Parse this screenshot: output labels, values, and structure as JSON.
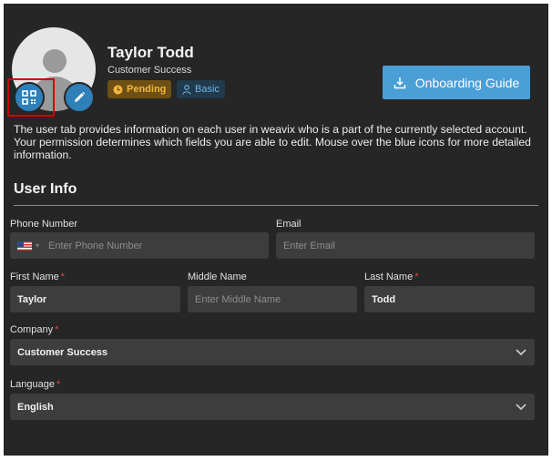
{
  "profile": {
    "name": "Taylor Todd",
    "role": "Customer Success",
    "status_badge": "Pending",
    "plan_badge": "Basic",
    "onboarding_button": "Onboarding Guide",
    "description": "The user tab provides information on each user in weavix who is a part of the currently selected account. Your permission determines which fields you are able to edit. Mouse over the blue icons for more detailed information."
  },
  "user_info": {
    "title": "User Info",
    "phone": {
      "label": "Phone Number",
      "placeholder": "Enter Phone Number",
      "flag": "us-flag-icon"
    },
    "email": {
      "label": "Email",
      "placeholder": "Enter Email"
    },
    "first_name": {
      "label": "First Name",
      "value": "Taylor",
      "required": "*"
    },
    "middle_name": {
      "label": "Middle Name",
      "placeholder": "Enter Middle Name"
    },
    "last_name": {
      "label": "Last Name",
      "value": "Todd",
      "required": "*"
    },
    "company": {
      "label": "Company",
      "value": "Customer Success",
      "required": "*"
    },
    "language": {
      "label": "Language",
      "value": "English",
      "required": "*"
    }
  },
  "icons": [
    "qr-code-icon",
    "pencil-icon",
    "clock-icon",
    "user-icon",
    "download-icon",
    "chevron-down-icon"
  ],
  "colors": {
    "background": "#262626",
    "field": "#3d3d3d",
    "accent": "#4a9fd6",
    "pending": "#f2b63a",
    "required": "#e24a4a",
    "highlight": "#d10000"
  }
}
